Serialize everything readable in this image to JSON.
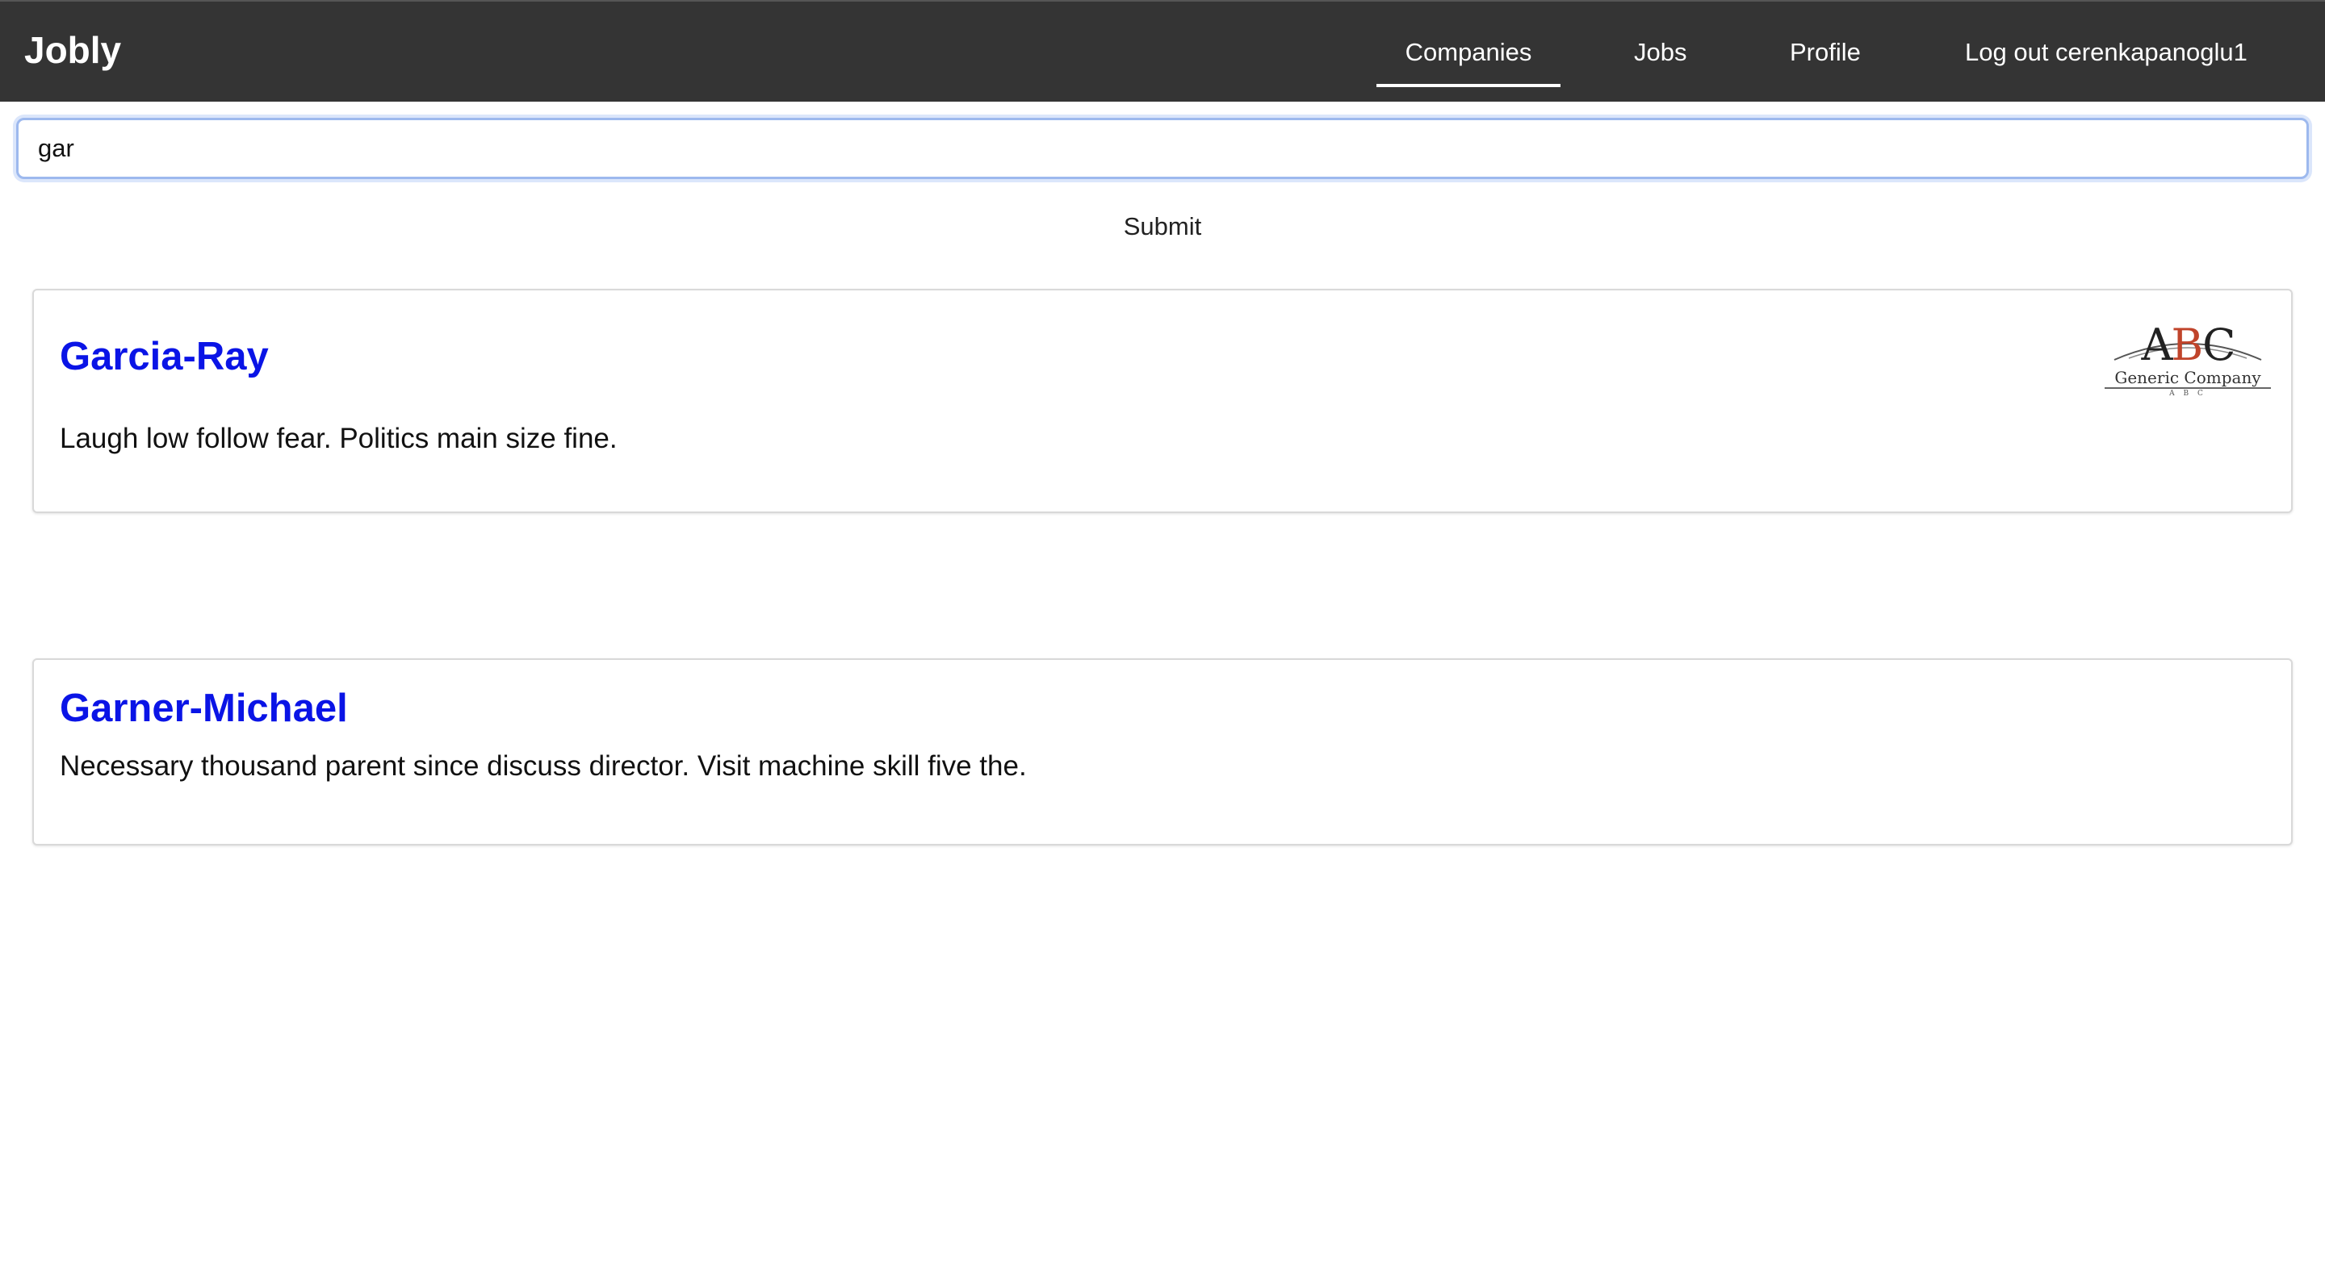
{
  "navbar": {
    "brand": "Jobly",
    "links": {
      "companies": "Companies",
      "jobs": "Jobs",
      "profile": "Profile",
      "logout": "Log out cerenkapanoglu1"
    },
    "active": "Companies",
    "background_color": "#343434"
  },
  "search": {
    "value": "gar",
    "submit_label": "Submit",
    "focus_color": "#9db9ee"
  },
  "companies": [
    {
      "name": "Garcia-Ray",
      "description": "Laugh low follow fear. Politics main size fine.",
      "logo": {
        "letter_1": "A",
        "letter_2": "B",
        "letter_3": "C",
        "company_text": "Generic Company",
        "sub_text": "A B C"
      }
    },
    {
      "name": "Garner-Michael",
      "description": "Necessary thousand parent since discuss director. Visit machine skill five the."
    }
  ],
  "colors": {
    "company_name": "#0a14e6",
    "logo_accent": "#c0442b"
  }
}
